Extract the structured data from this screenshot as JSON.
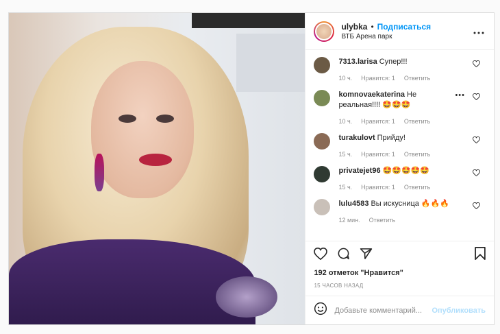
{
  "header": {
    "username": "ulybka",
    "separator": "•",
    "follow_label": "Подписаться",
    "location": "ВТБ Арена парк",
    "more_icon": "more-horizontal-icon"
  },
  "comments": [
    {
      "user": "7313.larisa",
      "text": "Супер!!!",
      "time": "10 ч.",
      "likes": "Нравится: 1",
      "reply": "Ответить",
      "avatar_color": "#6b5a45"
    },
    {
      "user": "komnovaekaterina",
      "text": "Не реальная!!!! 🤩🤩🤩",
      "time": "10 ч.",
      "likes": "Нравится: 1",
      "reply": "Ответить",
      "avatar_color": "#7a8a55"
    },
    {
      "user": "turakulovt",
      "text": "Прийду!",
      "time": "15 ч.",
      "likes": "Нравится: 1",
      "reply": "Ответить",
      "avatar_color": "#8a6a55"
    },
    {
      "user": "privatejet96",
      "text": "🤩🤩🤩🤩🤩",
      "time": "15 ч.",
      "likes": "Нравится: 1",
      "reply": "Ответить",
      "avatar_color": "#2f3a32"
    },
    {
      "user": "lulu4583",
      "text": "Вы искусница 🔥🔥🔥",
      "time": "12 мин.",
      "likes": "",
      "reply": "Ответить",
      "avatar_color": "#c9c0b8"
    }
  ],
  "actions": {
    "like_icon": "heart-icon",
    "comment_icon": "comment-icon",
    "share_icon": "share-icon",
    "save_icon": "bookmark-icon"
  },
  "likes_text": "192 отметок \"Нравится\"",
  "posted_time": "15 ЧАСОВ НАЗАД",
  "add_comment": {
    "placeholder": "Добавьте комментарий...",
    "publish_label": "Опубликовать"
  },
  "colors": {
    "accent": "#0095f6",
    "publish_disabled": "#b2dffc"
  }
}
